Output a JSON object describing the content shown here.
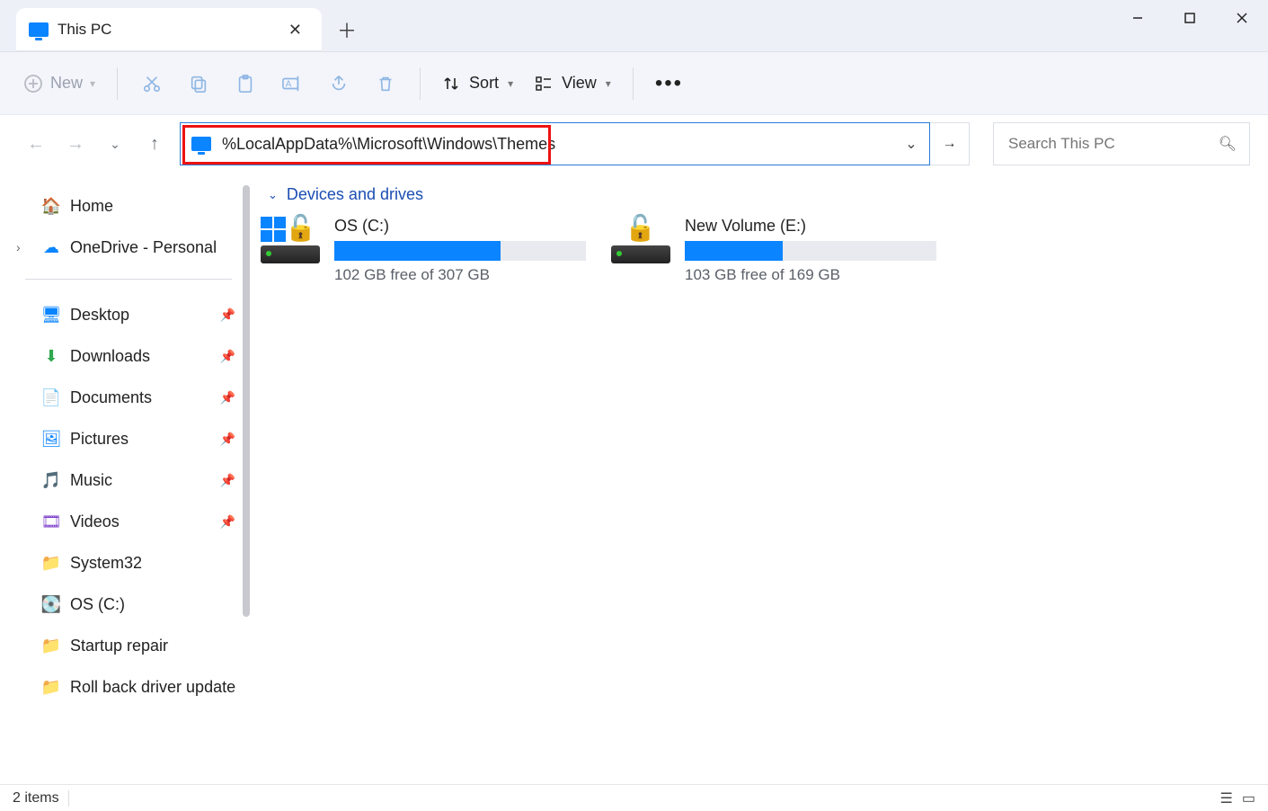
{
  "tab": {
    "title": "This PC"
  },
  "toolbar": {
    "new_label": "New",
    "sort_label": "Sort",
    "view_label": "View"
  },
  "address": {
    "path": "%LocalAppData%\\Microsoft\\Windows\\Themes"
  },
  "search": {
    "placeholder": "Search This PC"
  },
  "sidebar": {
    "home": "Home",
    "onedrive": "OneDrive - Personal",
    "items": [
      {
        "label": "Desktop",
        "pinned": true
      },
      {
        "label": "Downloads",
        "pinned": true
      },
      {
        "label": "Documents",
        "pinned": true
      },
      {
        "label": "Pictures",
        "pinned": true
      },
      {
        "label": "Music",
        "pinned": true
      },
      {
        "label": "Videos",
        "pinned": true
      },
      {
        "label": "System32",
        "pinned": false
      },
      {
        "label": "OS (C:)",
        "pinned": false
      },
      {
        "label": "Startup repair",
        "pinned": false
      },
      {
        "label": "Roll back driver update",
        "pinned": false
      }
    ]
  },
  "group": {
    "title": "Devices and drives"
  },
  "drives": [
    {
      "name": "OS (C:)",
      "sub": "102 GB free of 307 GB",
      "fill_pct": 66
    },
    {
      "name": "New Volume (E:)",
      "sub": "103 GB free of 169 GB",
      "fill_pct": 39
    }
  ],
  "status": {
    "text": "2 items"
  }
}
